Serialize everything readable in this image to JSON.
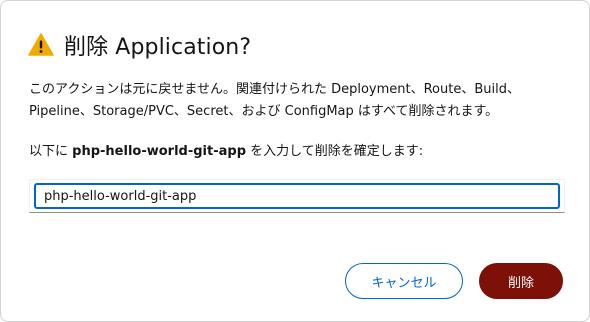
{
  "dialog": {
    "title": "削除 Application?",
    "icon": "warning-triangle-icon",
    "warning_color": "#f0ab00",
    "description": "このアクションは元に戻せません。関連付けられた Deployment、Route、Build、Pipeline、Storage/PVC、Secret、および ConfigMap はすべて削除されます。",
    "confirm_prefix": "以下に",
    "confirm_name": "php-hello-world-git-app",
    "confirm_suffix": "を入力して削除を確定します:",
    "input_value": "php-hello-world-git-app",
    "cancel_label": "キャンセル",
    "delete_label": "削除",
    "accent_color": "#0066cc",
    "danger_color": "#7d1007"
  }
}
